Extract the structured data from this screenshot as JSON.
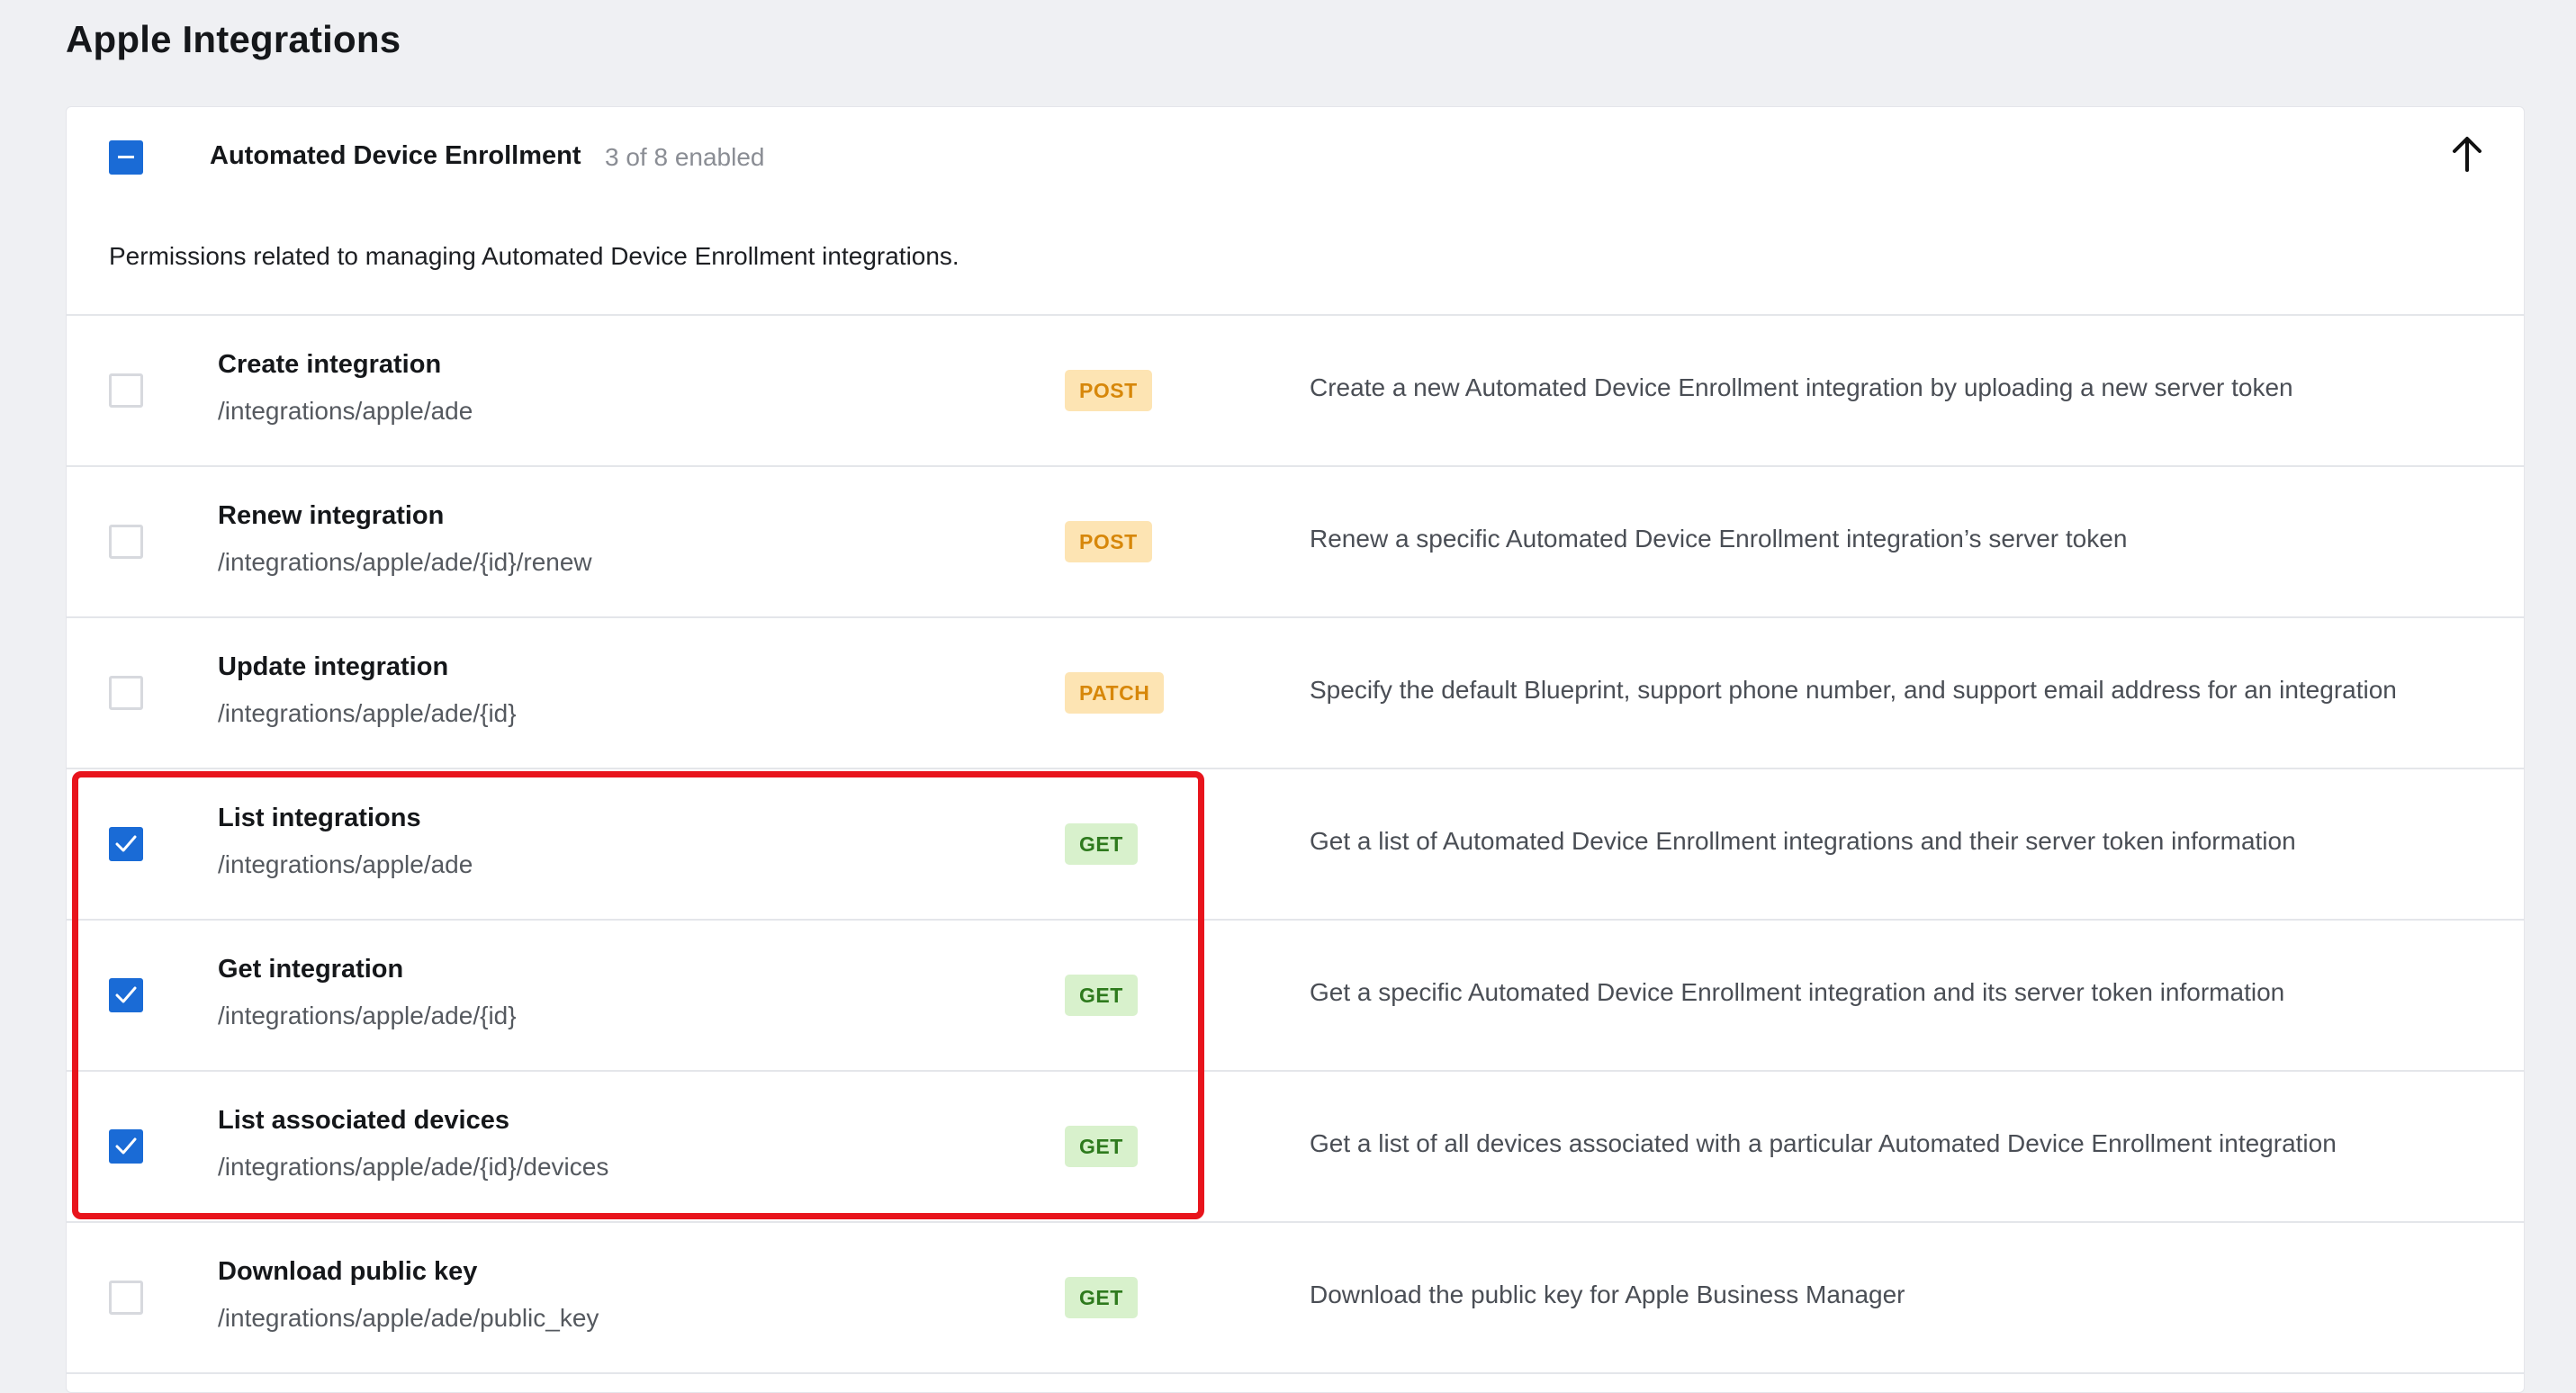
{
  "page": {
    "title": "Apple Integrations"
  },
  "group": {
    "title": "Automated Device Enrollment",
    "count": "3 of 8 enabled",
    "description": "Permissions related to managing Automated Device Enrollment integrations.",
    "check_state": "indeterminate",
    "collapse_icon": "arrow-up-icon"
  },
  "colors": {
    "accent": "#1a6bd6",
    "highlight": "#e8141c",
    "post_bg": "#fde4b3",
    "post_text": "#d7870a",
    "get_bg": "#d8f1cc",
    "get_text": "#2e7a1d"
  },
  "rows": [
    {
      "name": "Create integration",
      "path": "/integrations/apple/ade",
      "method": "POST",
      "description": "Create a new Automated Device Enrollment integration by uploading a new server token",
      "checked": false
    },
    {
      "name": "Renew integration",
      "path": "/integrations/apple/ade/{id}/renew",
      "method": "POST",
      "description": "Renew a specific Automated Device Enrollment integration’s server token",
      "checked": false
    },
    {
      "name": "Update integration",
      "path": "/integrations/apple/ade/{id}",
      "method": "PATCH",
      "description": "Specify the default Blueprint, support phone number, and support email address for an integration",
      "checked": false
    },
    {
      "name": "List integrations",
      "path": "/integrations/apple/ade",
      "method": "GET",
      "description": "Get a list of Automated Device Enrollment integrations and their server token information",
      "checked": true
    },
    {
      "name": "Get integration",
      "path": "/integrations/apple/ade/{id}",
      "method": "GET",
      "description": "Get a specific Automated Device Enrollment integration and its server token information",
      "checked": true
    },
    {
      "name": "List associated devices",
      "path": "/integrations/apple/ade/{id}/devices",
      "method": "GET",
      "description": "Get a list of all devices associated with a particular Automated Device Enrollment integration",
      "checked": true
    },
    {
      "name": "Download public key",
      "path": "/integrations/apple/ade/public_key",
      "method": "GET",
      "description": "Download the public key for Apple Business Manager",
      "checked": false
    }
  ]
}
